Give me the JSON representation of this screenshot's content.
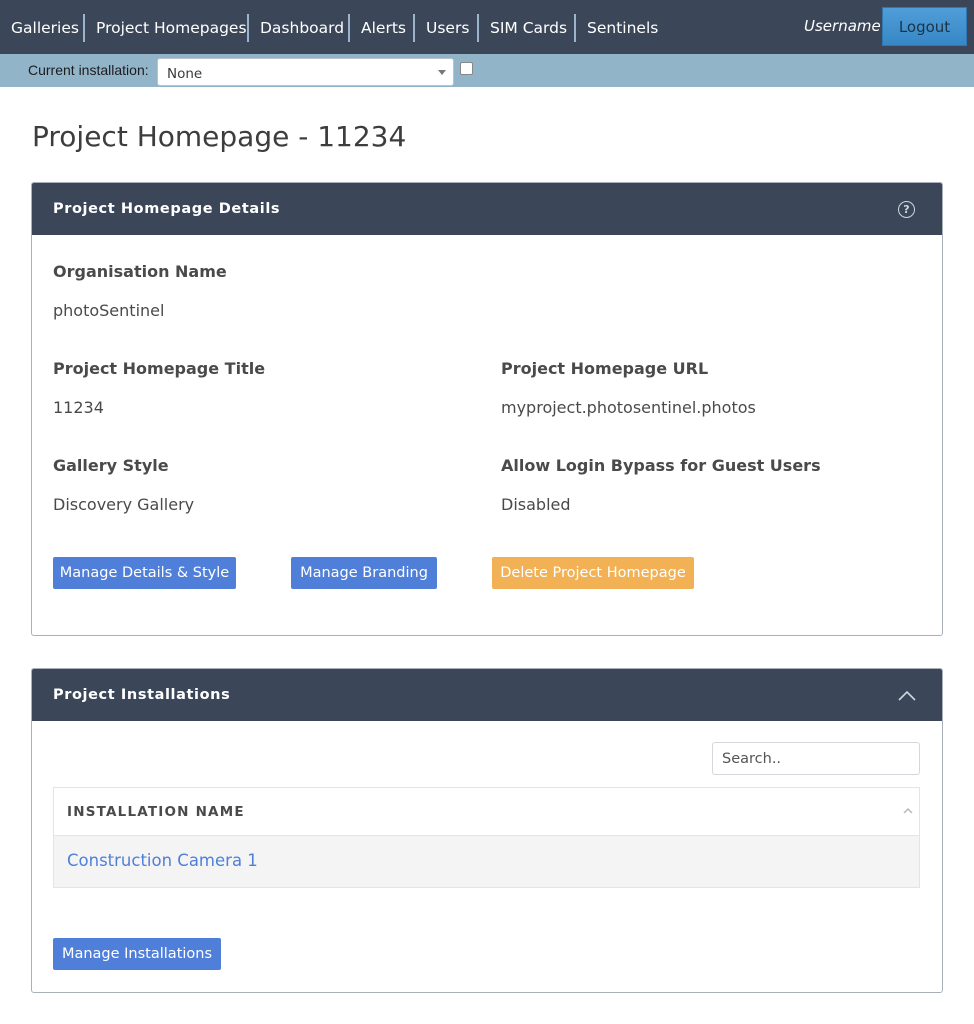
{
  "nav": {
    "items": [
      "Galleries",
      "Project Homepages",
      "Dashboard",
      "Alerts",
      "Users",
      "SIM Cards",
      "Sentinels"
    ],
    "username": "Username",
    "logout_label": "Logout"
  },
  "installation_bar": {
    "label": "Current installation:",
    "selected": "None"
  },
  "page": {
    "title": "Project Homepage - 11234"
  },
  "details_panel": {
    "title": "Project Homepage Details",
    "help_icon": "question-circle-icon",
    "fields": {
      "org_name_label": "Organisation Name",
      "org_name_value": "photoSentinel",
      "homepage_title_label": "Project Homepage Title",
      "homepage_title_value": "11234",
      "homepage_url_label": "Project Homepage URL",
      "homepage_url_value": "myproject.photosentinel.photos",
      "gallery_style_label": "Gallery Style",
      "gallery_style_value": "Discovery Gallery",
      "login_bypass_label": "Allow Login Bypass for Guest Users",
      "login_bypass_value": "Disabled"
    },
    "buttons": {
      "manage_details": "Manage Details & Style",
      "manage_branding": "Manage Branding",
      "delete_homepage": "Delete Project Homepage"
    }
  },
  "installations_panel": {
    "title": "Project Installations",
    "collapse_icon": "chevron-up-icon",
    "search_placeholder": "Search..",
    "table": {
      "column_header": "INSTALLATION NAME",
      "rows": [
        "Construction Camera 1"
      ]
    },
    "manage_button": "Manage Installations"
  },
  "colors": {
    "navbar": "#3b4758",
    "install_bar": "#92b4c9",
    "primary": "#4f7fd9",
    "warning": "#f2b155"
  }
}
